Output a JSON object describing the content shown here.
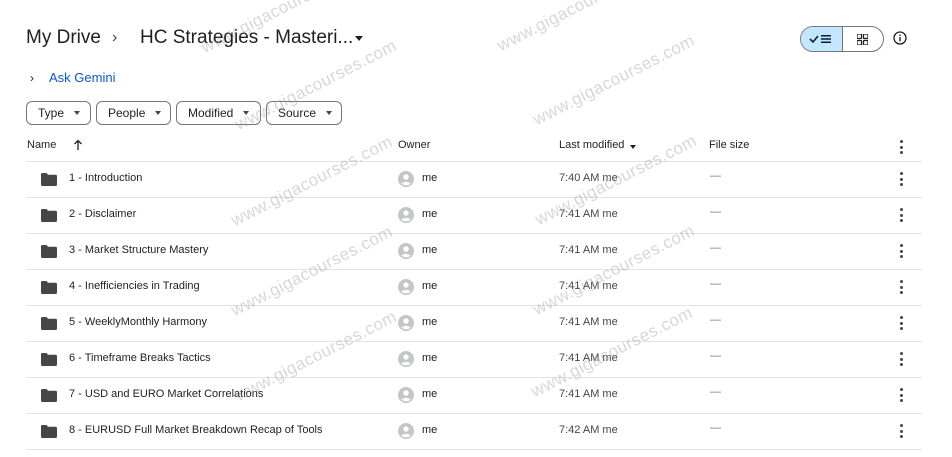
{
  "breadcrumb": {
    "root": "My Drive",
    "separator": "›",
    "current": "HC Strategies - Masteri..."
  },
  "gemini": {
    "label": "Ask Gemini",
    "chevron": "›"
  },
  "filters": [
    "Type",
    "People",
    "Modified",
    "Source"
  ],
  "columns": {
    "name": "Name",
    "owner": "Owner",
    "last_modified": "Last modified",
    "file_size": "File size"
  },
  "rows": [
    {
      "name": "1 - Introduction",
      "owner": "me",
      "modified": "7:40 AM me",
      "size": "—"
    },
    {
      "name": "2 - Disclaimer",
      "owner": "me",
      "modified": "7:41 AM me",
      "size": "—"
    },
    {
      "name": "3 - Market Structure Mastery",
      "owner": "me",
      "modified": "7:41 AM me",
      "size": "—"
    },
    {
      "name": "4 - Inefficiencies in Trading",
      "owner": "me",
      "modified": "7:41 AM me",
      "size": "—"
    },
    {
      "name": "5 - WeeklyMonthly Harmony",
      "owner": "me",
      "modified": "7:41 AM me",
      "size": "—"
    },
    {
      "name": "6 - Timeframe Breaks Tactics",
      "owner": "me",
      "modified": "7:41 AM me",
      "size": "—"
    },
    {
      "name": "7 - USD and EURO Market Correlations",
      "owner": "me",
      "modified": "7:41 AM me",
      "size": "—"
    },
    {
      "name": "8 - EURUSD Full Market Breakdown Recap of Tools",
      "owner": "me",
      "modified": "7:42 AM me",
      "size": "—"
    }
  ],
  "watermark": "www.gigacourses.com",
  "colors": {
    "accent": "#0b57d0",
    "toggle_active": "#c2e7ff",
    "divider": "#e1e3e1"
  },
  "icons": {
    "view_list": "check-list-icon",
    "view_grid": "grid-icon",
    "info": "info-icon",
    "folder": "folder-icon",
    "avatar": "person-avatar-icon",
    "more": "more-vert-icon",
    "sort": "arrow-up-icon"
  }
}
